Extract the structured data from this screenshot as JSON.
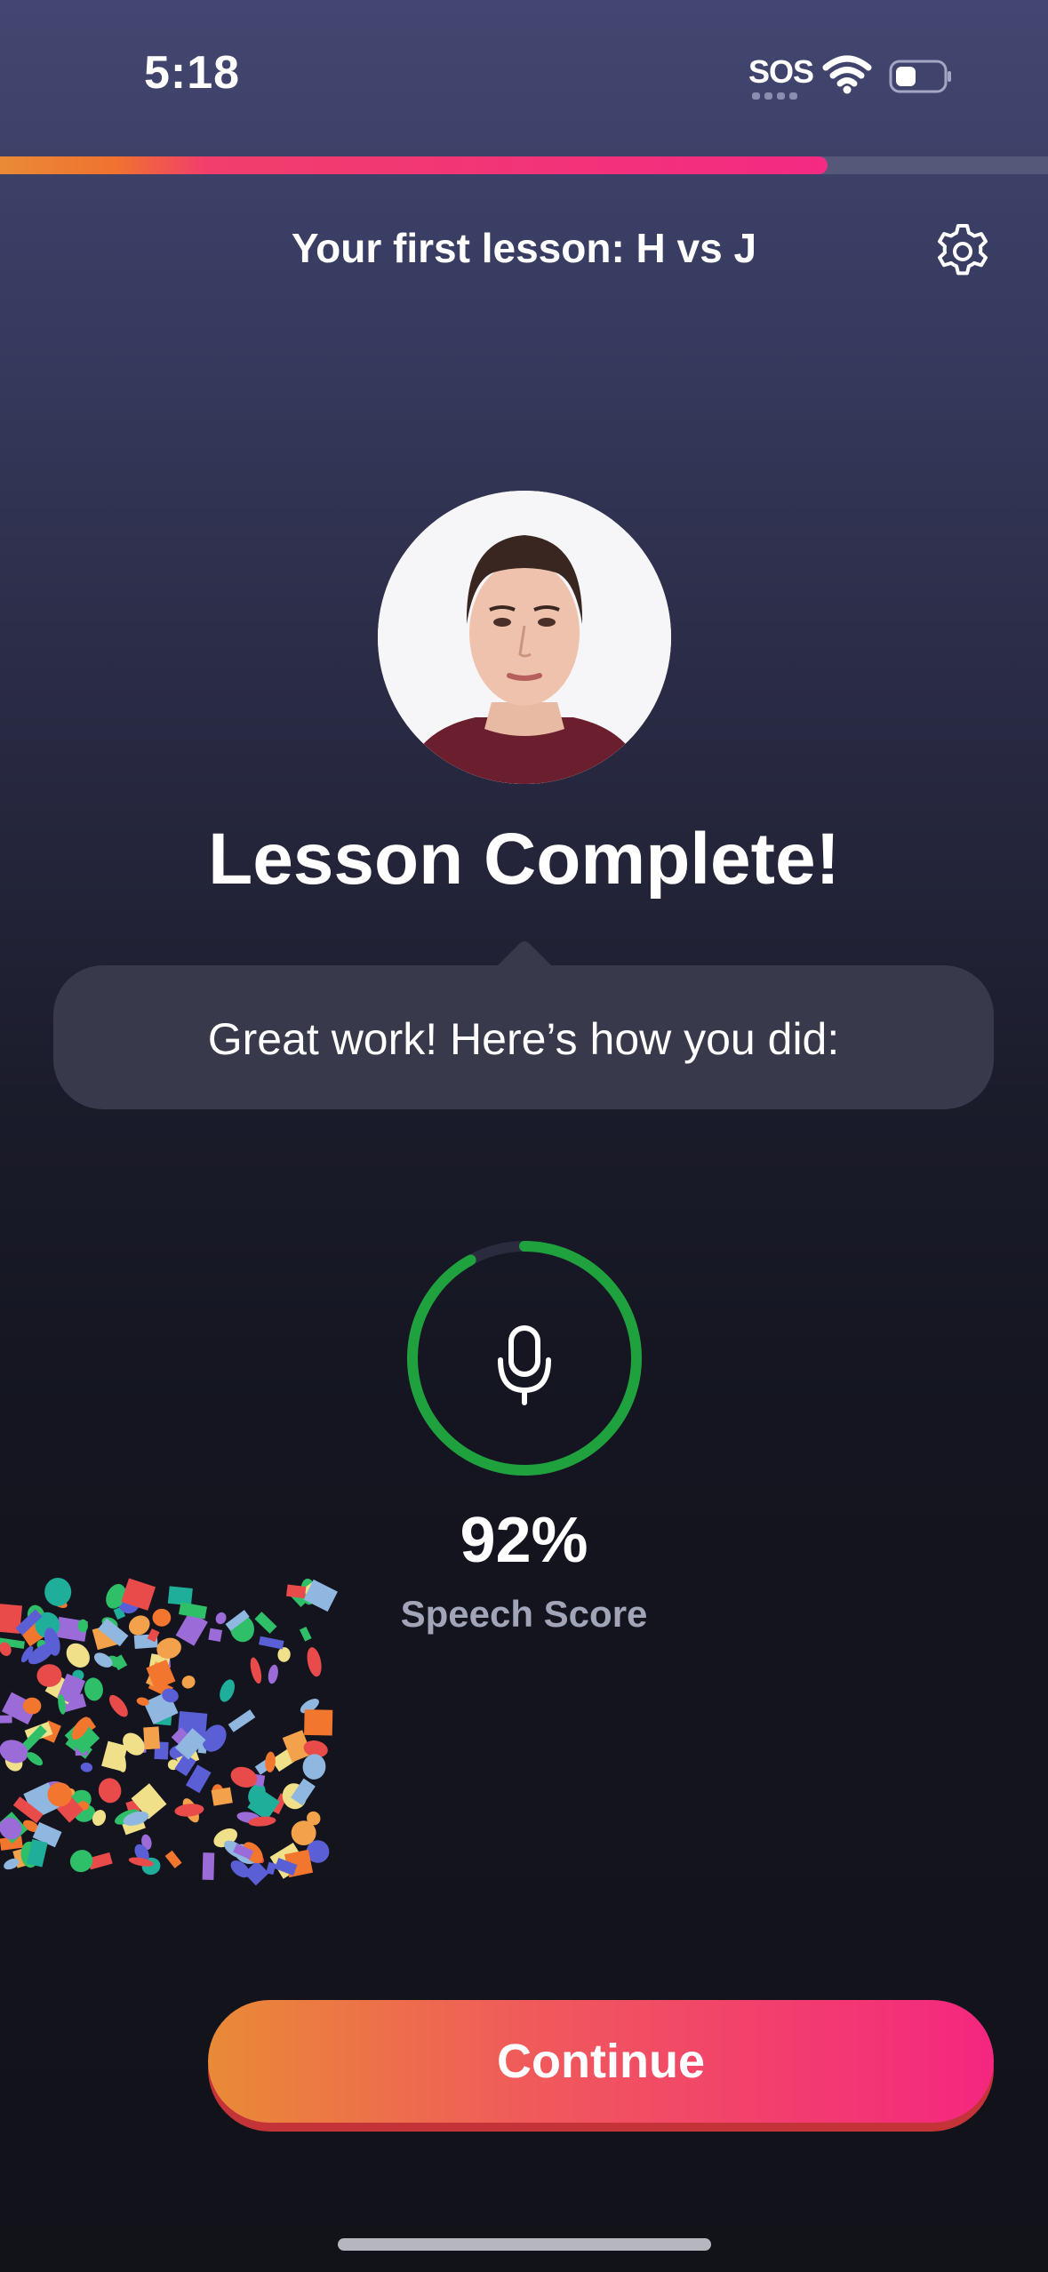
{
  "status_bar": {
    "time": "5:18",
    "sos": "SOS"
  },
  "progress": {
    "fraction": 0.79,
    "colors": [
      "#e98a36",
      "#f42a83"
    ]
  },
  "header": {
    "title": "Your first lesson: H vs J",
    "settings_icon": "gear-icon"
  },
  "avatar": {
    "icon": "tutor-portrait"
  },
  "lesson": {
    "title": "Lesson Complete!"
  },
  "bubble": {
    "text": "Great work! Here’s how you did:"
  },
  "score": {
    "value": "92%",
    "fraction": 0.92,
    "label": "Speech Score",
    "icon": "microphone-icon",
    "ring_color": "#1fa23d"
  },
  "actions": {
    "continue_label": "Continue"
  }
}
